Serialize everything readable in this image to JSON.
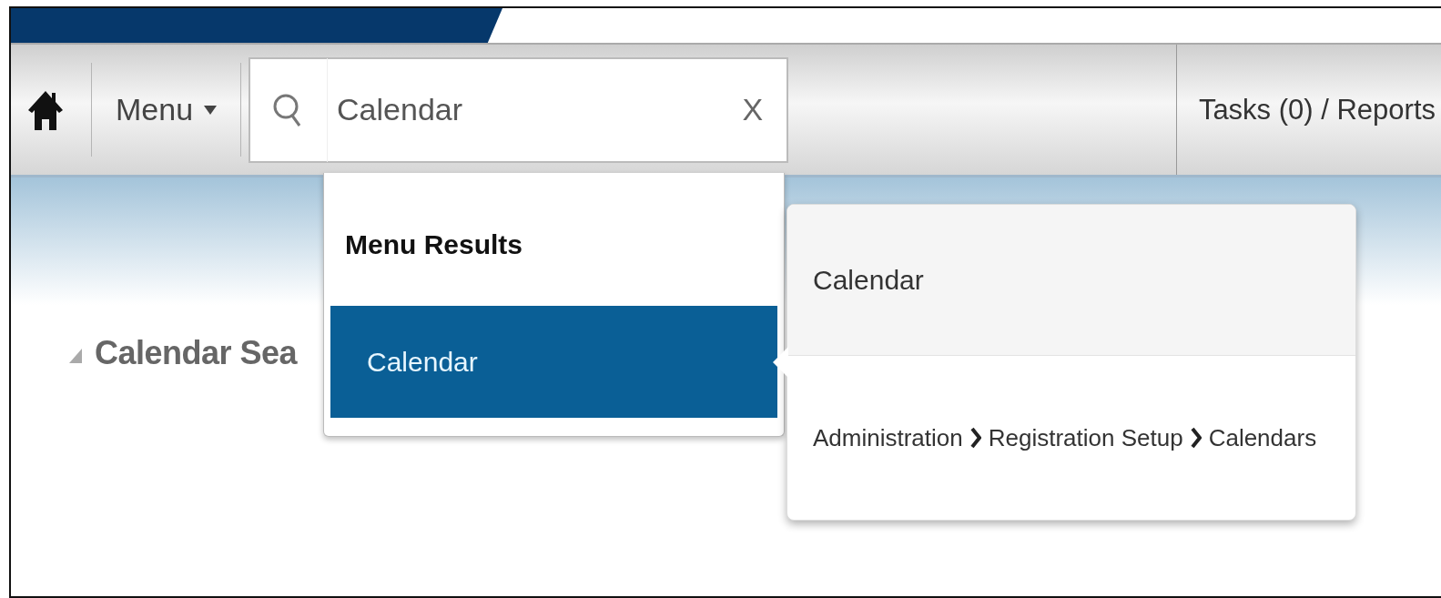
{
  "toolbar": {
    "menu_button": "Menu",
    "search": {
      "value": "Calendar",
      "clear_label": "X"
    },
    "tasks_link": "Tasks (0) / Reports"
  },
  "page_heading": "Calendar Sea",
  "search_results": {
    "heading": "Menu Results",
    "items": [
      {
        "label": "Calendar",
        "selected": true
      }
    ]
  },
  "result_detail": {
    "title": "Calendar",
    "path": [
      "Administration",
      "Registration Setup",
      "Calendars"
    ]
  }
}
